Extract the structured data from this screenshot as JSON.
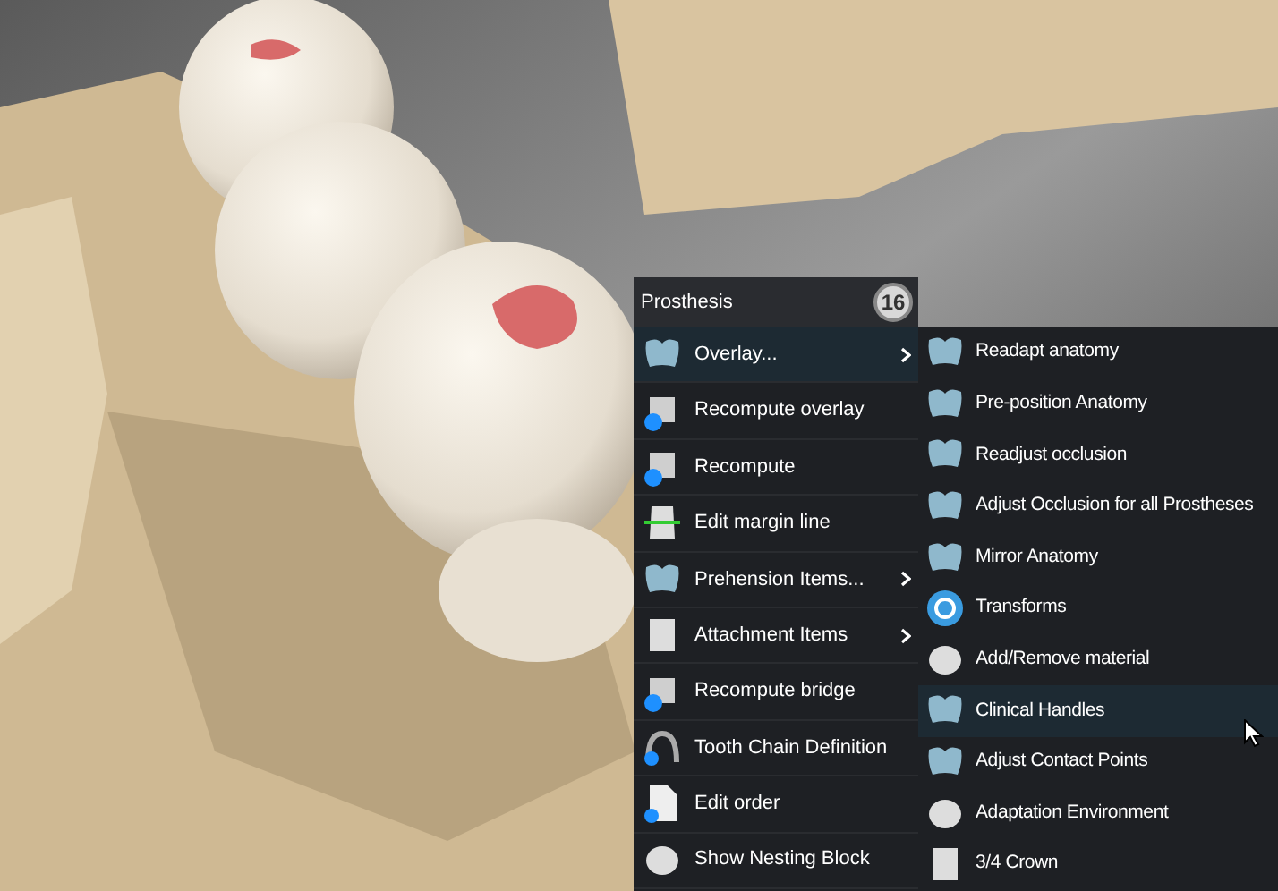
{
  "menu": {
    "title": "Prosthesis",
    "badge": "16",
    "items": [
      {
        "label": "Overlay...",
        "selected": true,
        "submenu": true
      },
      {
        "label": "Recompute overlay",
        "selected": false,
        "submenu": false
      },
      {
        "label": "Recompute",
        "selected": false,
        "submenu": false
      },
      {
        "label": "Edit margin line",
        "selected": false,
        "submenu": false
      },
      {
        "label": "Prehension Items...",
        "selected": false,
        "submenu": true
      },
      {
        "label": "Attachment Items",
        "selected": false,
        "submenu": true
      },
      {
        "label": "Recompute bridge",
        "selected": false,
        "submenu": false
      },
      {
        "label": "Tooth Chain Definition",
        "selected": false,
        "submenu": false
      },
      {
        "label": "Edit order",
        "selected": false,
        "submenu": false
      },
      {
        "label": "Show Nesting Block",
        "selected": false,
        "submenu": false
      }
    ]
  },
  "submenu": {
    "items": [
      {
        "label": "Readapt anatomy",
        "selected": false
      },
      {
        "label": "Pre-position Anatomy",
        "selected": false
      },
      {
        "label": "Readjust occlusion",
        "selected": false
      },
      {
        "label": "Adjust Occlusion for all Prostheses",
        "selected": false
      },
      {
        "label": "Mirror Anatomy",
        "selected": false
      },
      {
        "label": "Transforms",
        "selected": false
      },
      {
        "label": "Add/Remove material",
        "selected": false
      },
      {
        "label": "Clinical Handles",
        "selected": true
      },
      {
        "label": "Adjust Contact Points",
        "selected": false
      },
      {
        "label": "Adaptation Environment",
        "selected": false
      },
      {
        "label": "3/4 Crown",
        "selected": false
      }
    ]
  }
}
